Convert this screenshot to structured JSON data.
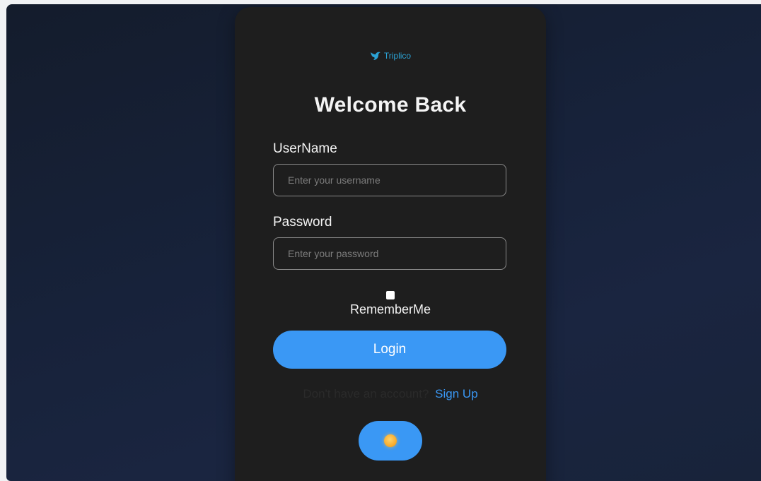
{
  "brand": {
    "name": "Triplico",
    "color": "#2ba3d6",
    "icon": "bird-icon"
  },
  "form": {
    "title": "Welcome Back",
    "username_label": "UserName",
    "username_placeholder": "Enter your username",
    "username_value": "",
    "password_label": "Password",
    "password_placeholder": "Enter your password",
    "password_value": "",
    "remember_label": "RememberMe",
    "remember_checked": false,
    "login_label": "Login",
    "signup_prompt": "Don't have an account?",
    "signup_link": "Sign Up"
  },
  "theme_toggle": {
    "icon": "sun-icon"
  },
  "colors": {
    "accent": "#3a98f5",
    "card": "#1e1e1e",
    "background": "#17223a"
  }
}
